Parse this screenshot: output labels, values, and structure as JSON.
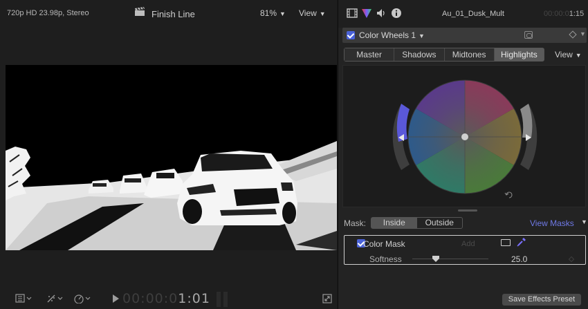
{
  "viewer": {
    "format_info": "720p HD 23.98p, Stereo",
    "project_title": "Finish Line",
    "zoom": "81%",
    "view_label": "View",
    "timecode_dim": "00:00:0",
    "timecode_bright": "1:01"
  },
  "inspector": {
    "clip_name": "Au_01_Dusk_Mult",
    "timecode_dim": "00:00:0",
    "timecode_bright": "1:15",
    "effect_name": "Color Wheels 1",
    "effect_enabled": true,
    "range_tabs": [
      "Master",
      "Shadows",
      "Midtones",
      "Highlights"
    ],
    "active_range": "Highlights",
    "view_label": "View",
    "mask": {
      "label": "Mask:",
      "options": [
        "Inside",
        "Outside"
      ],
      "active": "Inside",
      "view_masks_label": "View Masks"
    },
    "color_mask": {
      "label": "Color Mask",
      "enabled": true,
      "add_label": "Add",
      "softness_label": "Softness",
      "softness_value": "25.0",
      "softness_fraction": 0.27
    },
    "save_preset_label": "Save Effects Preset"
  },
  "icons": [
    "clapper-icon",
    "chevron-down-icon",
    "viewer-layout-icon",
    "transform-tools-icon",
    "speed-icon",
    "play-icon",
    "fullscreen-icon",
    "video-inspector-icon",
    "color-inspector-icon",
    "audio-inspector-icon",
    "info-icon",
    "mask-shape-icon",
    "keyframe-icon",
    "reset-icon",
    "eyedropper-icon"
  ],
  "colors": {
    "accent_blue": "#4a62d8",
    "link_blue": "#6f79e6",
    "background": "#1a1a1a"
  }
}
